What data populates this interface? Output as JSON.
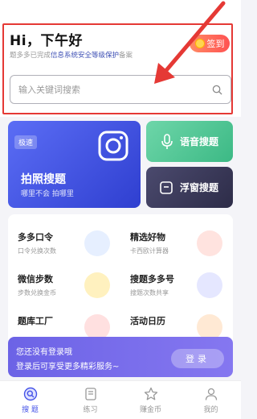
{
  "header": {
    "greeting": "Hi，下午好",
    "checkin_label": "签到",
    "notice_prefix": "题多多已完成",
    "notice_highlight": "信息系统安全等级保护",
    "notice_suffix": "备案",
    "search_placeholder": "输入关键词搜索"
  },
  "features": {
    "photo": {
      "badge": "极速",
      "title": "拍照搜题",
      "subtitle": "哪里不会 拍哪里"
    },
    "voice": {
      "title": "语音搜题"
    },
    "float": {
      "title": "浮窗搜题"
    }
  },
  "tools": [
    {
      "title": "多多口令",
      "subtitle": "口令兑换次数",
      "icon": "phone-coupon-icon",
      "color": "#7fa7ff"
    },
    {
      "title": "精选好物",
      "subtitle": "卡西欧计算器",
      "icon": "gift-icon",
      "color": "#ff7a6b"
    },
    {
      "title": "微信步数",
      "subtitle": "步数兑换金币",
      "icon": "duck-icon",
      "color": "#ffcf33"
    },
    {
      "title": "搜题多多号",
      "subtitle": "搜题次数共享",
      "icon": "share-icon",
      "color": "#6f7bf0"
    },
    {
      "title": "题库工厂",
      "subtitle": "",
      "icon": "envelope-icon",
      "color": "#ff5a5a"
    },
    {
      "title": "活动日历",
      "subtitle": "",
      "icon": "calendar-icon",
      "color": "#ff9a3c"
    }
  ],
  "login_banner": {
    "line1": "您还没有登录哦",
    "line2": "登录后可享受更多精彩服务~",
    "button": "登录"
  },
  "tabs": [
    {
      "label": "搜 题",
      "icon": "search-tab-icon",
      "active": true
    },
    {
      "label": "练习",
      "icon": "book-icon",
      "active": false
    },
    {
      "label": "赚金币",
      "icon": "star-icon",
      "active": false
    },
    {
      "label": "我的",
      "icon": "user-icon",
      "active": false
    }
  ],
  "colors": {
    "accent": "#4553e8",
    "annotation": "#e53935"
  }
}
